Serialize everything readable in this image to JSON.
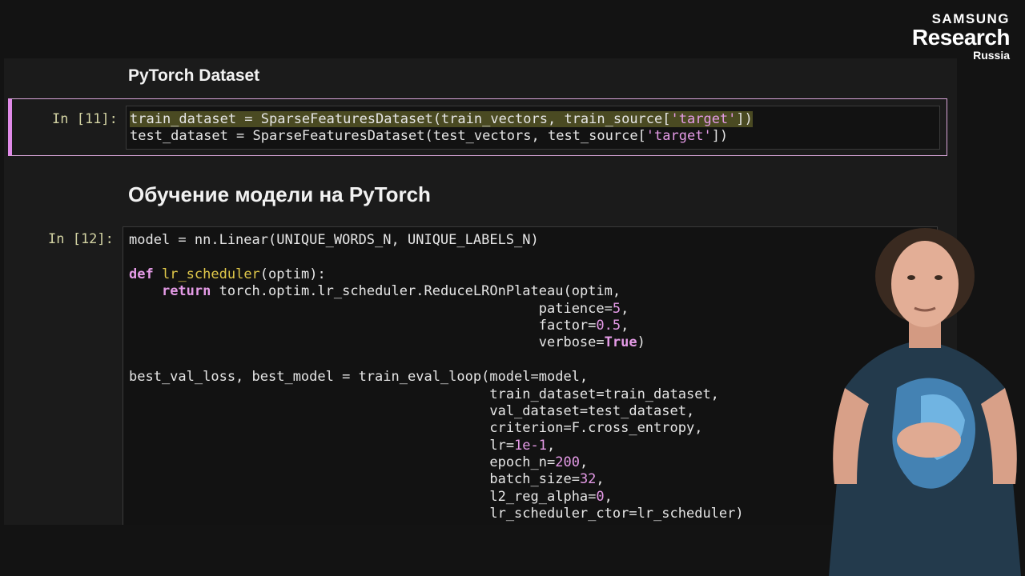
{
  "brand": {
    "line1": "SAMSUNG",
    "line2": "Research",
    "line3": "Russia"
  },
  "notebook": {
    "heading1": "PyTorch Dataset",
    "cell11": {
      "prompt": "In [11]:",
      "lines": [
        [
          "train_dataset = SparseFeaturesDataset(train_vectors, train_source[",
          "'target'",
          "])"
        ],
        [
          "test_dataset = SparseFeaturesDataset(test_vectors, test_source[",
          "'target'",
          "])"
        ]
      ]
    },
    "heading2": "Обучение модели на PyTorch",
    "cell12": {
      "prompt": "In [12]:",
      "line1": "model = nn.Linear(UNIQUE_WORDS_N, UNIQUE_LABELS_N)",
      "def_kw": "def",
      "def_name": "lr_scheduler",
      "def_args": "(optim):",
      "return_kw": "return",
      "return_rest": " torch.optim.lr_scheduler.ReduceLROnPlateau(optim,",
      "patience_key": "patience=",
      "patience_val": "5",
      "factor_key": "factor=",
      "factor_val": "0.5",
      "verbose_key": "verbose=",
      "verbose_val": "True",
      "call_line": "best_val_loss, best_model = train_eval_loop(model=model,",
      "arg_train": "train_dataset=train_dataset,",
      "arg_val": "val_dataset=test_dataset,",
      "arg_crit": "criterion=F.cross_entropy,",
      "lr_key": "lr=",
      "lr_val": "1e-1",
      "epoch_key": "epoch_n=",
      "epoch_val": "200",
      "batch_key": "batch_size=",
      "batch_val": "32",
      "l2_key": "l2_reg_alpha=",
      "l2_val": "0",
      "sched_arg": "lr_scheduler_ctor=lr_scheduler)"
    }
  },
  "colors": {
    "keyword": "#e59be7",
    "function": "#e0c84a",
    "highlight": "#4a4a22",
    "selected_border": "#e08ae8"
  }
}
